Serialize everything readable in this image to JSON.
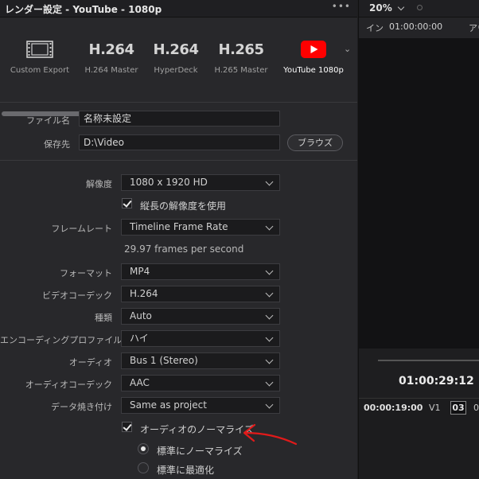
{
  "window": {
    "title": "レンダー設定 - YouTube - 1080p",
    "more_glyph": "•••"
  },
  "presets": [
    {
      "codec": "",
      "label": "Custom Export",
      "icon": "film-icon"
    },
    {
      "codec": "H.264",
      "label": "H.264 Master"
    },
    {
      "codec": "H.264",
      "label": "HyperDeck"
    },
    {
      "codec": "H.265",
      "label": "H.265 Master"
    },
    {
      "codec": "",
      "label": "YouTube 1080p",
      "icon": "youtube-icon",
      "active": true
    }
  ],
  "file": {
    "name_label": "ファイル名",
    "name_value": "名称未設定",
    "location_label": "保存先",
    "location_value": "D:\\Video",
    "browse_label": "ブラウズ"
  },
  "settings": {
    "resolution_label": "解像度",
    "resolution_value": "1080 x 1920 HD",
    "vertical_res_label": "縦長の解像度を使用",
    "framerate_label": "フレームレート",
    "framerate_value": "Timeline Frame Rate",
    "framerate_info": "29.97 frames per second",
    "format_label": "フォーマット",
    "format_value": "MP4",
    "video_codec_label": "ビデオコーデック",
    "video_codec_value": "H.264",
    "type_label": "種類",
    "type_value": "Auto",
    "encoding_profile_label": "エンコーディングプロファイル",
    "encoding_profile_value": "ハイ",
    "audio_label": "オーディオ",
    "audio_value": "Bus 1 (Stereo)",
    "audio_codec_label": "オーディオコーデック",
    "audio_codec_value": "AAC",
    "data_burn_label": "データ焼き付け",
    "data_burn_value": "Same as project",
    "audio_normalize_label": "オーディオのノーマライズ",
    "normalize_standard_label": "標準にノーマライズ",
    "normalize_optimize_label": "標準に最適化"
  },
  "viewer": {
    "zoom": "20%",
    "in_label": "イン",
    "in_time": "01:00:00:00",
    "out_label": "アウト",
    "timecode": "01:00:29:12",
    "timeline_time": "00:00:19:00",
    "track": "V1",
    "frame_box": "03",
    "next_glyph": "0"
  },
  "colors": {
    "accent_red": "#e11a1a",
    "youtube_red": "#ff0000"
  }
}
